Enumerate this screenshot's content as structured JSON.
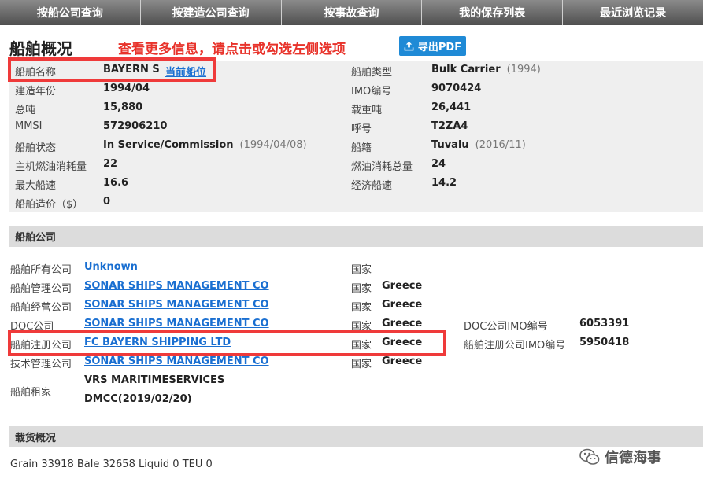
{
  "nav": {
    "tabs": [
      "按船公司查询",
      "按建造公司查询",
      "按事故查询",
      "我的保存列表",
      "最近浏览记录"
    ]
  },
  "header": {
    "title": "船舶概况",
    "notice": "查看更多信息，请点击或勾选左侧选项",
    "pdf_label": "导出PDF"
  },
  "overview": {
    "name_label": "船舶名称",
    "name_value": "BAYERN S",
    "position_link": "当前船位",
    "type_label": "船舶类型",
    "type_value": "Bulk Carrier",
    "type_year": "(1994)",
    "built_label": "建造年份",
    "built_value": "1994/04",
    "imo_label": "IMO编号",
    "imo_value": "9070424",
    "gt_label": "总吨",
    "gt_value": "15,880",
    "dwt_label": "载重吨",
    "dwt_value": "26,441",
    "mmsi_label": "MMSI",
    "mmsi_value": "572906210",
    "callsign_label": "呼号",
    "callsign_value": "T2ZA4",
    "status_label": "船舶状态",
    "status_value": "In Service/Commission",
    "status_date": "(1994/04/08)",
    "flag_label": "船籍",
    "flag_value": "Tuvalu",
    "flag_date": "(2016/11)",
    "main_fuel_label": "主机燃油消耗量",
    "main_fuel_value": "22",
    "total_fuel_label": "燃油消耗总量",
    "total_fuel_value": "24",
    "max_speed_label": "最大船速",
    "max_speed_value": "16.6",
    "eco_speed_label": "经济船速",
    "eco_speed_value": "14.2",
    "cost_label": "船舶造价（$）",
    "cost_value": "0"
  },
  "companies": {
    "section_title": "船舶公司",
    "country_label": "国家",
    "owner_label": "船舶所有公司",
    "owner_value": "Unknown",
    "owner_country": "",
    "manager_label": "船舶管理公司",
    "manager_value": "SONAR SHIPS MANAGEMENT CO",
    "manager_country": "Greece",
    "operator_label": "船舶经营公司",
    "operator_value": "SONAR SHIPS MANAGEMENT CO",
    "operator_country": "Greece",
    "doc_label": "DOC公司",
    "doc_value": "SONAR SHIPS MANAGEMENT CO",
    "doc_country": "Greece",
    "doc_imo_label": "DOC公司IMO编号",
    "doc_imo_value": "6053391",
    "registered_label": "船舶注册公司",
    "registered_value": "FC BAYERN SHIPPING LTD",
    "registered_country": "Greece",
    "registered_imo_label": "船舶注册公司IMO编号",
    "registered_imo_value": "5950418",
    "technical_label": "技术管理公司",
    "technical_value": "SONAR SHIPS MANAGEMENT CO",
    "technical_country": "Greece",
    "charterer_label": "船舶租家",
    "charterer_line1": "VRS MARITIMESERVICES",
    "charterer_line2": "DMCC(2019/02/20)"
  },
  "cargo": {
    "section_title": "载货概况",
    "text": "Grain 33918 Bale 32658 Liquid 0 TEU 0"
  },
  "watermark": {
    "text": "信德海事",
    "icon": "wechat-icon"
  },
  "colors": {
    "nav_bg": "#5e5e5e",
    "accent_red": "#ef3a3a",
    "link_blue": "#1a6fd1",
    "pdf_blue": "#1f8ad6",
    "panel_bg": "#efefef",
    "section_bg": "#dcdcdc"
  }
}
